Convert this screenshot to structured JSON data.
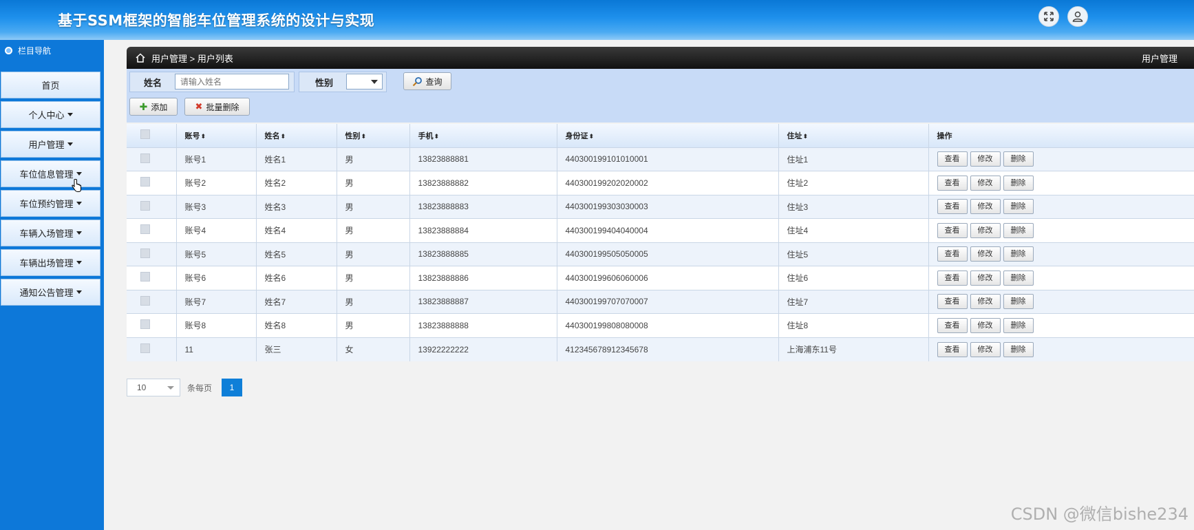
{
  "header": {
    "title": "基于SSM框架的智能车位管理系统的设计与实现",
    "icons": [
      "fullscreen-icon",
      "user-icon"
    ],
    "colors": {
      "primary": "#1e90ec",
      "sidebar": "#0d78d9",
      "accent": "#0f7fd8"
    }
  },
  "sidebar": {
    "title": "栏目导航",
    "items": [
      {
        "label": "首页"
      },
      {
        "label": "个人中心"
      },
      {
        "label": "用户管理"
      },
      {
        "label": "车位信息管理"
      },
      {
        "label": "车位预约管理"
      },
      {
        "label": "车辆入场管理"
      },
      {
        "label": "车辆出场管理"
      },
      {
        "label": "通知公告管理"
      }
    ]
  },
  "breadcrumb": {
    "path": "用户管理 > 用户列表",
    "right_title": "用户管理"
  },
  "search": {
    "name_label": "姓名",
    "name_placeholder": "请输入姓名",
    "gender_label": "性别",
    "gender_value": "",
    "query_button": "查询"
  },
  "actions": {
    "add_button": "添加",
    "batch_delete_button": "批量删除"
  },
  "table": {
    "columns": [
      "账号",
      "姓名",
      "性别",
      "手机",
      "身份证",
      "住址",
      "操作"
    ],
    "rows": [
      {
        "account": "账号1",
        "name": "姓名1",
        "gender": "男",
        "phone": "13823888881",
        "idcard": "440300199101010001",
        "address": "住址1"
      },
      {
        "account": "账号2",
        "name": "姓名2",
        "gender": "男",
        "phone": "13823888882",
        "idcard": "440300199202020002",
        "address": "住址2"
      },
      {
        "account": "账号3",
        "name": "姓名3",
        "gender": "男",
        "phone": "13823888883",
        "idcard": "440300199303030003",
        "address": "住址3"
      },
      {
        "account": "账号4",
        "name": "姓名4",
        "gender": "男",
        "phone": "13823888884",
        "idcard": "440300199404040004",
        "address": "住址4"
      },
      {
        "account": "账号5",
        "name": "姓名5",
        "gender": "男",
        "phone": "13823888885",
        "idcard": "440300199505050005",
        "address": "住址5"
      },
      {
        "account": "账号6",
        "name": "姓名6",
        "gender": "男",
        "phone": "13823888886",
        "idcard": "440300199606060006",
        "address": "住址6"
      },
      {
        "account": "账号7",
        "name": "姓名7",
        "gender": "男",
        "phone": "13823888887",
        "idcard": "440300199707070007",
        "address": "住址7"
      },
      {
        "account": "账号8",
        "name": "姓名8",
        "gender": "男",
        "phone": "13823888888",
        "idcard": "440300199808080008",
        "address": "住址8"
      },
      {
        "account": "11",
        "name": "张三",
        "gender": "女",
        "phone": "13922222222",
        "idcard": "412345678912345678",
        "address": "上海浦东11号"
      }
    ],
    "row_actions": [
      "查看",
      "修改",
      "删除"
    ]
  },
  "pagination": {
    "page_size": "10",
    "per_page_label": "条每页",
    "current_page": "1"
  },
  "watermark": "CSDN @微信bishe234"
}
